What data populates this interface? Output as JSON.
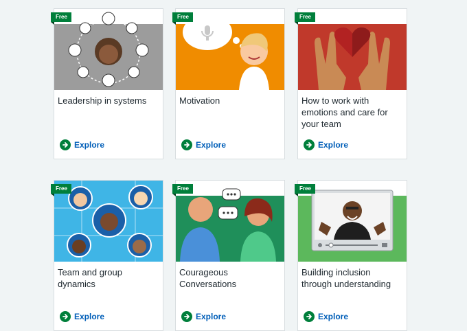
{
  "badge_text": "Free",
  "explore_label": "Explore",
  "cards": [
    {
      "title": "Leadership in systems"
    },
    {
      "title": "Motivation"
    },
    {
      "title": "How to work with emotions and care for your team"
    },
    {
      "title": "Team and group dynamics"
    },
    {
      "title": "Courageous Conversations"
    },
    {
      "title": "Building inclusion through understanding"
    }
  ],
  "colors": {
    "badge": "#007f3b",
    "link": "#005eb8",
    "page_bg": "#f0f4f5",
    "thumb_leadership": "#9c9c9c",
    "thumb_motivation": "#f08c00",
    "thumb_emotions": "#c0392b",
    "thumb_team": "#3fb5e6",
    "thumb_conversations": "#1f8f5a",
    "thumb_inclusion": "#5cb85c"
  }
}
